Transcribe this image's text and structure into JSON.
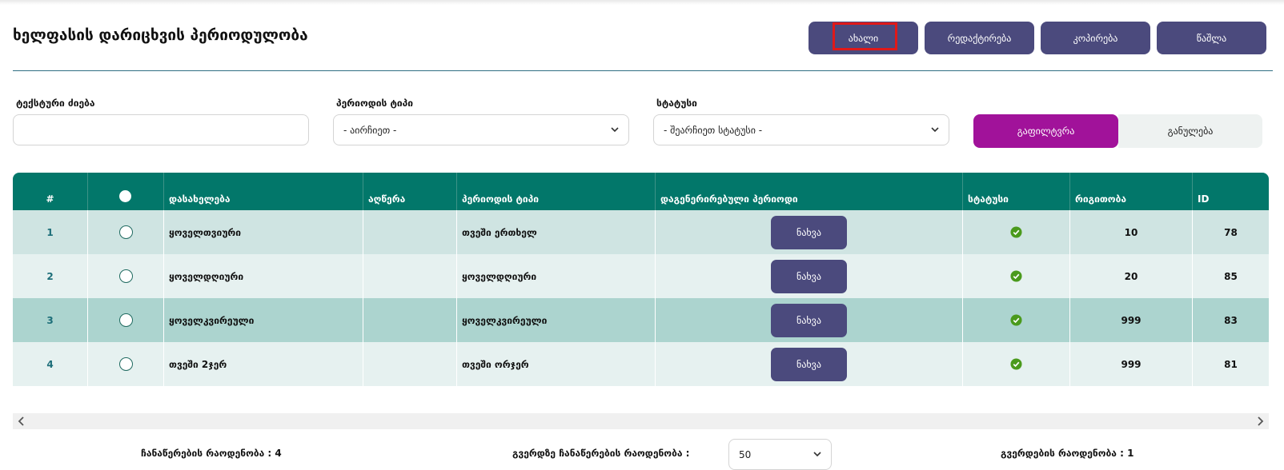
{
  "page": {
    "title": "ხელფასის დარიცხვის პერიოდულობა"
  },
  "toolbar": {
    "new_label": "ახალი",
    "edit_label": "რედაქტირება",
    "copy_label": "კოპირება",
    "delete_label": "წაშლა"
  },
  "filters": {
    "search_label": "ტექსტური ძიება",
    "search_value": "",
    "period_type_label": "პერიოდის ტიპი",
    "period_type_value": "- აირჩიეთ -",
    "status_label": "სტატუსი",
    "status_value": "- შეარჩიეთ სტატუსი -",
    "filter_button": "გაფილტვრა",
    "clear_button": "განულება"
  },
  "table": {
    "headers": {
      "index": "#",
      "name": "დასახელება",
      "description": "აღწერა",
      "period_type": "პერიოდის ტიპი",
      "generated_period": "დაგენერირებული პერიოდი",
      "status": "სტატუსი",
      "order": "რიგითობა",
      "id": "ID"
    },
    "rows": [
      {
        "index": "1",
        "name": "ყოველთვიური",
        "description": "",
        "period_type": "თვეში ერთხელ",
        "view": "ნახვა",
        "status": "active",
        "order": "10",
        "id": "78"
      },
      {
        "index": "2",
        "name": "ყოველდღიური",
        "description": "",
        "period_type": "ყოველდღიური",
        "view": "ნახვა",
        "status": "active",
        "order": "20",
        "id": "85"
      },
      {
        "index": "3",
        "name": "ყოველკვირეული",
        "description": "",
        "period_type": "ყოველკვირეული",
        "view": "ნახვა",
        "status": "active",
        "order": "999",
        "id": "83"
      },
      {
        "index": "4",
        "name": "თვეში 2ჯერ",
        "description": "",
        "period_type": "თვეში ორჯერ",
        "view": "ნახვა",
        "status": "active",
        "order": "999",
        "id": "81"
      }
    ]
  },
  "footer": {
    "record_count": "ჩანაწერების რაოდენობა : 4",
    "per_page_label": "გვერდზე ჩანაწერების რაოდენობა :",
    "per_page_value": "50",
    "page_count": "გვერდების რაოდენობა : 1"
  },
  "colors": {
    "primary_button": "#4b4a7d",
    "table_header": "#02776a",
    "filter_button": "#a1129a",
    "status_ok": "#4a9a1c",
    "highlight": "#e01919"
  }
}
